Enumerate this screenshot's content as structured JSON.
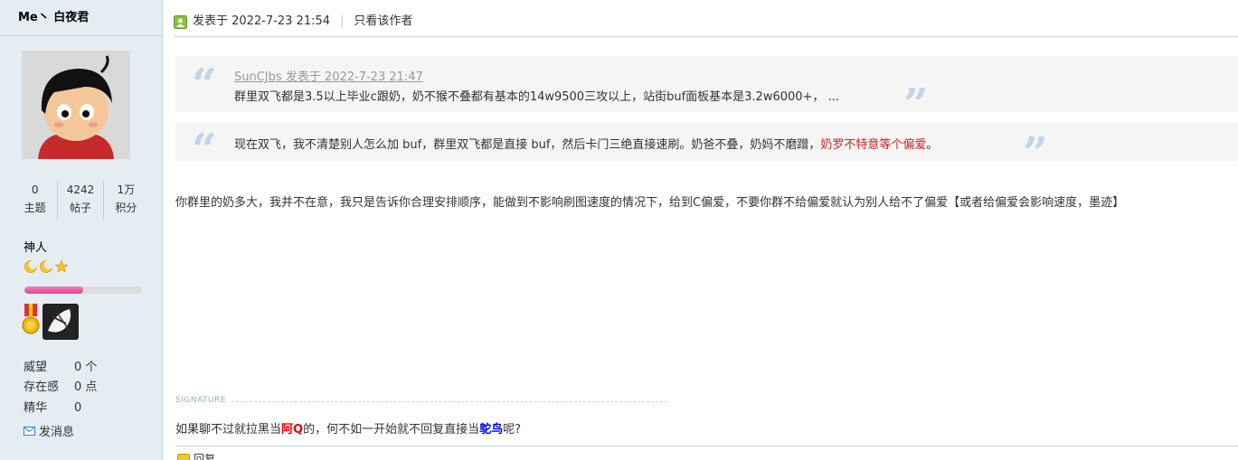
{
  "sidebar": {
    "author_name": "Me丶 白夜君",
    "stats": [
      {
        "num": "0",
        "label": "主题"
      },
      {
        "num": "4242",
        "label": "帖子"
      },
      {
        "num": "1万",
        "label": "积分"
      }
    ],
    "rank": "神人",
    "level_progress": 0.5,
    "reputation_label": "威望",
    "reputation_value": "0 个",
    "presence_label": "存在感",
    "presence_value": "0 点",
    "digest_label": "精华",
    "digest_value": "0",
    "send_message": "发消息"
  },
  "post": {
    "posted_at": "发表于 2022-7-23 21:54",
    "only_author": "只看该作者",
    "quote1_meta": "SunCJbs 发表于 2022-7-23 21:47",
    "quote1_text": "群里双飞都是3.5以上毕业c跟奶，奶不猴不叠都有基本的14w9500三攻以上，站街buf面板基本是3.2w6000+， ...",
    "quote2_text": "现在双飞，我不清楚别人怎么加 buf，群里双飞都是直接 buf，然后卡门三绝直接速刷。奶爸不叠，奶妈不磨蹭，",
    "quote2_red": "奶罗不特意等个偏爱",
    "quote2_end": "。",
    "body": "你群里的奶多大，我并不在意，我只是告诉你合理安排顺序，能做到不影响刷图速度的情况下，给到C偏爱，不要你群不给偏爱就认为别人给不了偏爱【或者给偏爱会影响速度，墨迹】",
    "signature_label": "SIGNATURE",
    "sig_part1": "如果聊不过就拉黑当",
    "sig_red": "阿Q",
    "sig_part2": "的，何不如一开始就不回复直接当",
    "sig_blue": "鸵鸟",
    "sig_part3": "呢?",
    "reply_label": "回复"
  },
  "colors": {
    "sidebar_bg": "#e5edf2",
    "border": "#c2d5e3",
    "quote_mark": "#c1d4ec",
    "quote_bg": "#f5f5f5",
    "highlight_red": "#cc2222",
    "progress_pink": "#e0418f"
  },
  "icons": [
    "user-post-icon",
    "moon-star-icon",
    "medal-icon",
    "envelope-icon",
    "open-quote-icon",
    "close-quote-icon"
  ]
}
